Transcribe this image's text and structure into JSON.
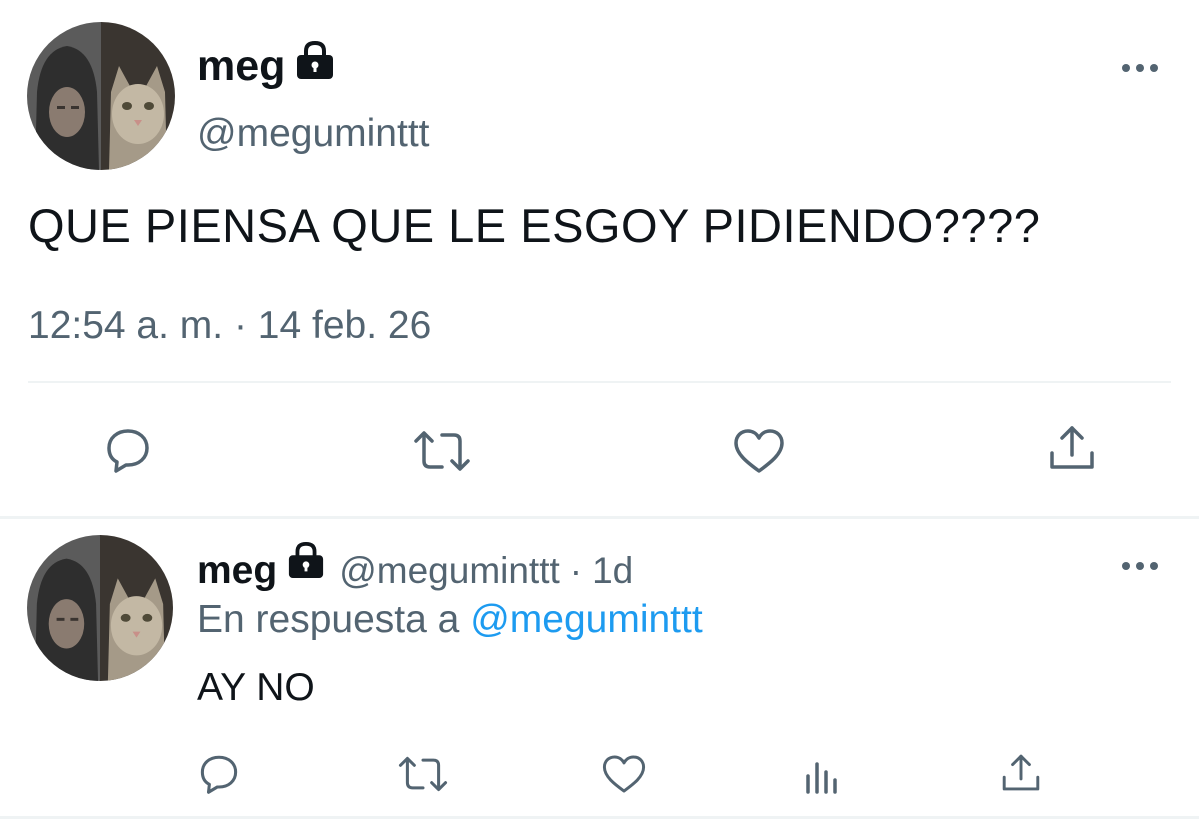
{
  "main_tweet": {
    "author_name": "meg",
    "handle": "@meguminttt",
    "text": "QUE PIENSA QUE LE ESGOY PIDIENDO????",
    "timestamp": "12:54 a. m. · 14 feb. 26",
    "protected_icon": "lock-icon",
    "more_icon": "more-icon",
    "actions": [
      "reply-icon",
      "retweet-icon",
      "like-icon",
      "share-icon"
    ]
  },
  "reply_tweet": {
    "author_name": "meg",
    "handle": "@meguminttt",
    "separator": "·",
    "time_ago": "1d",
    "reply_prefix": "En respuesta a",
    "reply_mention": "@meguminttt",
    "text": "AY NO",
    "actions": [
      "reply-icon",
      "retweet-icon",
      "like-icon",
      "analytics-icon",
      "share-icon"
    ]
  },
  "colors": {
    "text": "#0f1419",
    "secondary": "#536471",
    "accent": "#1d9bf0",
    "divider": "#eff3f4"
  }
}
